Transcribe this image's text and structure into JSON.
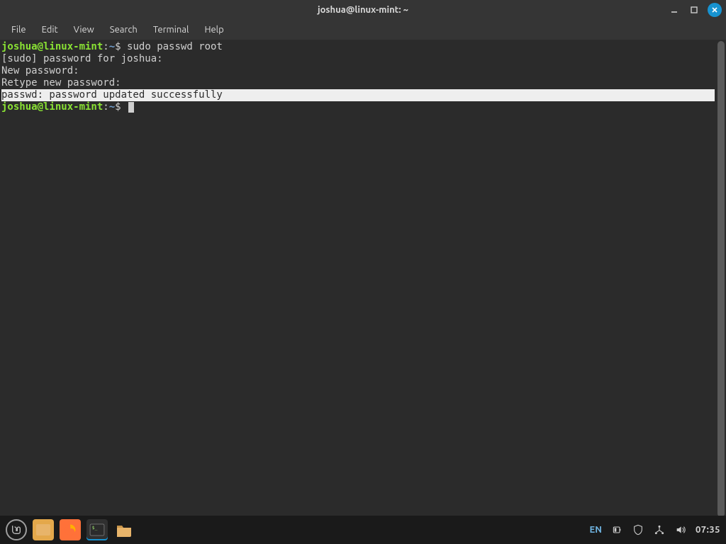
{
  "window": {
    "title": "joshua@linux-mint: ~"
  },
  "menubar": {
    "items": [
      "File",
      "Edit",
      "View",
      "Search",
      "Terminal",
      "Help"
    ]
  },
  "terminal": {
    "prompt_user_host": "joshua@linux-mint",
    "prompt_sep": ":",
    "prompt_path": "~",
    "prompt_symbol": "$",
    "lines": {
      "cmd1": "sudo passwd root",
      "line2": "[sudo] password for joshua: ",
      "line3": "New password: ",
      "line4": "Retype new password: ",
      "line5": "passwd: password updated successfully"
    }
  },
  "panel": {
    "lang": "EN",
    "clock": "07:35"
  }
}
